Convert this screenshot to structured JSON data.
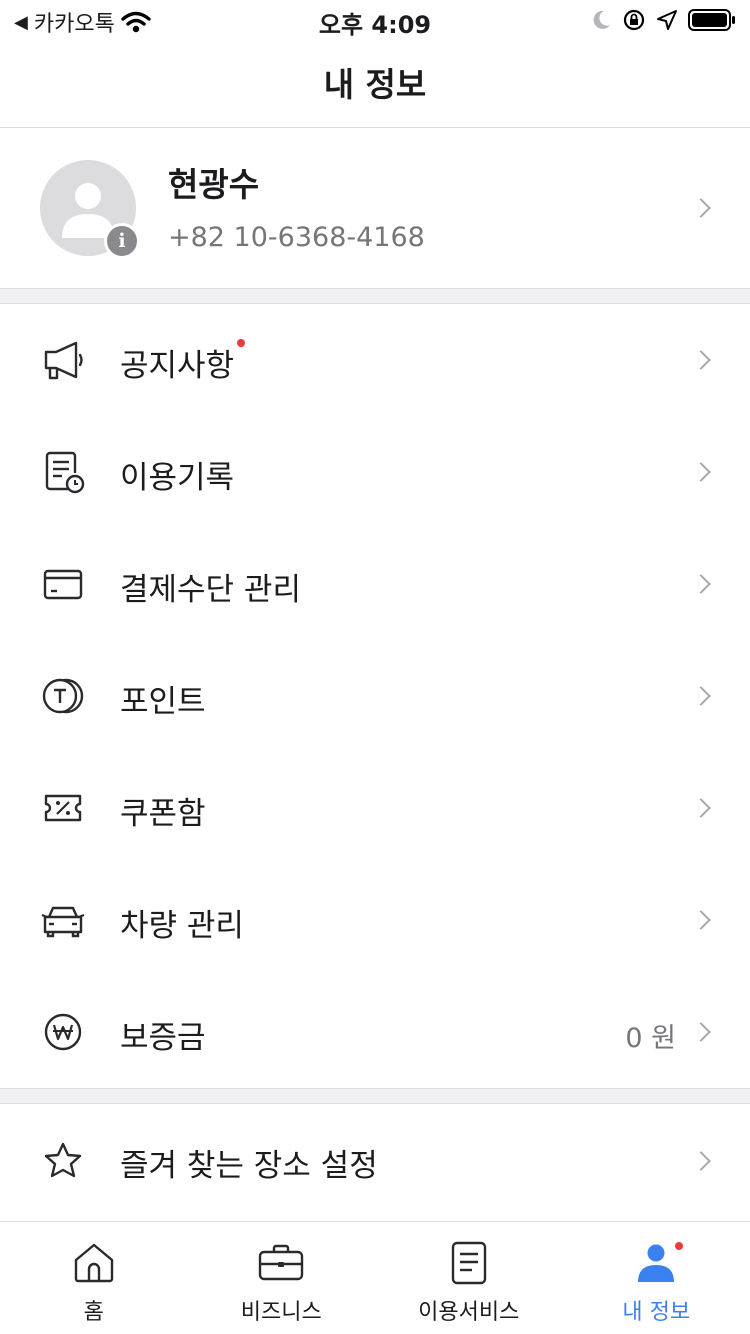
{
  "status_bar": {
    "back_app": "카카오톡",
    "time": "오후 4:09"
  },
  "nav": {
    "title": "내 정보"
  },
  "profile": {
    "name": "현광수",
    "phone": "+82 10-6368-4168",
    "info_badge": "i"
  },
  "menu": {
    "notice": "공지사항",
    "history": "이용기록",
    "payment": "결제수단 관리",
    "points": "포인트",
    "coupons": "쿠폰함",
    "vehicle": "차량 관리",
    "deposit": "보증금",
    "deposit_value": "0 원",
    "favorites": "즐겨 찾는 장소 설정"
  },
  "tabs": {
    "home": "홈",
    "business": "비즈니스",
    "services": "이용서비스",
    "my_info": "내 정보"
  },
  "colors": {
    "accent": "#3b82f0",
    "notification_dot": "#ee3a3a"
  }
}
